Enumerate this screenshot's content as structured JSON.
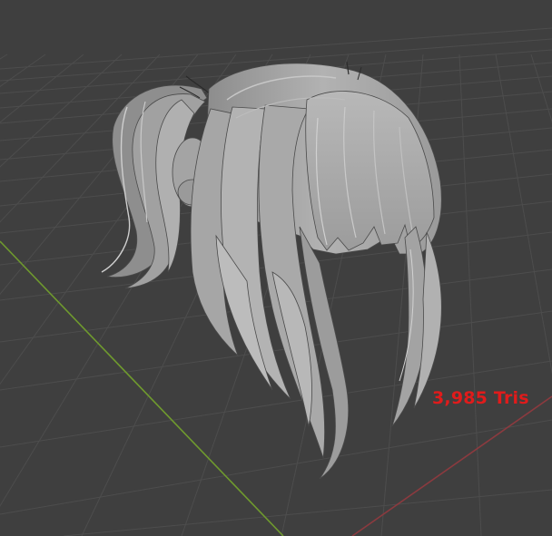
{
  "viewport": {
    "background": "#3f3f3f",
    "grid_color": "#4c4c4c",
    "axis_x_color": "#8b3a3f",
    "axis_y_color": "#6f9a2e",
    "hair_color": "#a7a7a7"
  },
  "overlay": {
    "triangle_count_label": "3,985 Tris",
    "label_color": "#e01b1b"
  }
}
